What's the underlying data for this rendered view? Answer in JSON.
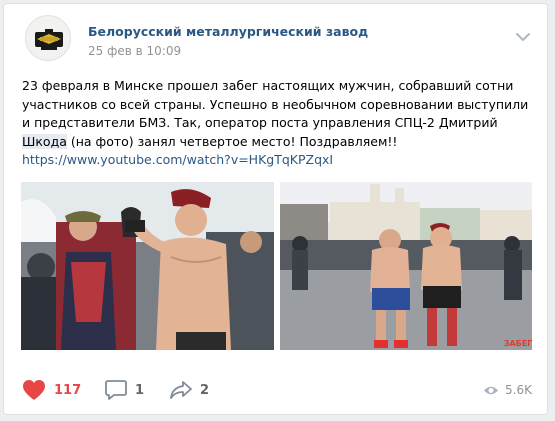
{
  "post": {
    "author": "Белорусский металлургический завод",
    "date": "25 фев в 10:09",
    "text_part1": "23 февраля в Минске прошел забег настоящих мужчин, собравший сотни участников со всей страны. Успешно в необычном соревновании выступили и представители БМЗ. Так, оператор поста управления СПЦ-2 Дмитрий ",
    "text_highlight": "Шкода",
    "text_part2": " (на фото) занял четвертое место! Поздравляем!!",
    "link": "https://www.youtube.com/watch?v=HKgTqKPZqxI",
    "photo_watermark": "ЗАБЕГ"
  },
  "actions": {
    "likes": "117",
    "comments": "1",
    "shares": "2",
    "views": "5.6K"
  },
  "colors": {
    "like": "#e64646",
    "link": "#2a5885",
    "muted": "#939393"
  },
  "icons": {
    "like": "heart-icon",
    "comment": "comment-icon",
    "share": "share-icon",
    "views": "eye-icon",
    "menu": "chevron-down-icon"
  }
}
